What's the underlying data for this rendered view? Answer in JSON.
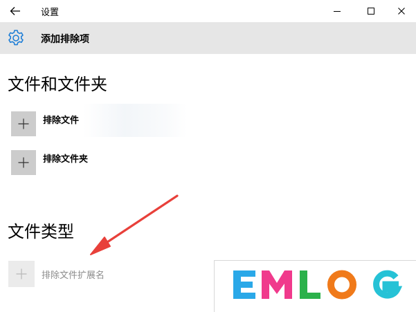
{
  "titlebar": {
    "title": "设置",
    "back_icon": "arrow-left-icon",
    "minimize_icon": "minimize-icon",
    "maximize_icon": "maximize-icon",
    "close_icon": "close-icon"
  },
  "header": {
    "icon": "gear-icon",
    "title": "添加排除项"
  },
  "sections": [
    {
      "heading": "文件和文件夹",
      "items": [
        {
          "label": "排除文件",
          "icon": "plus-icon",
          "enabled": true
        },
        {
          "label": "排除文件夹",
          "icon": "plus-icon",
          "enabled": true
        }
      ]
    },
    {
      "heading": "文件类型",
      "items": [
        {
          "label": "排除文件扩展名",
          "icon": "plus-icon",
          "enabled": false
        }
      ]
    }
  ],
  "annotation": {
    "color": "#e8403a"
  },
  "watermark": {
    "text": "EMLOG",
    "colors": [
      "#2aa8e8",
      "#f03a8c",
      "#2bb14b",
      "#f07a1a",
      "#26c2d6"
    ]
  },
  "colors": {
    "header_bg": "#e6e6e6",
    "accent": "#1e7ed6",
    "button_bg": "#cccccc",
    "button_disabled_bg": "#ebebeb"
  }
}
